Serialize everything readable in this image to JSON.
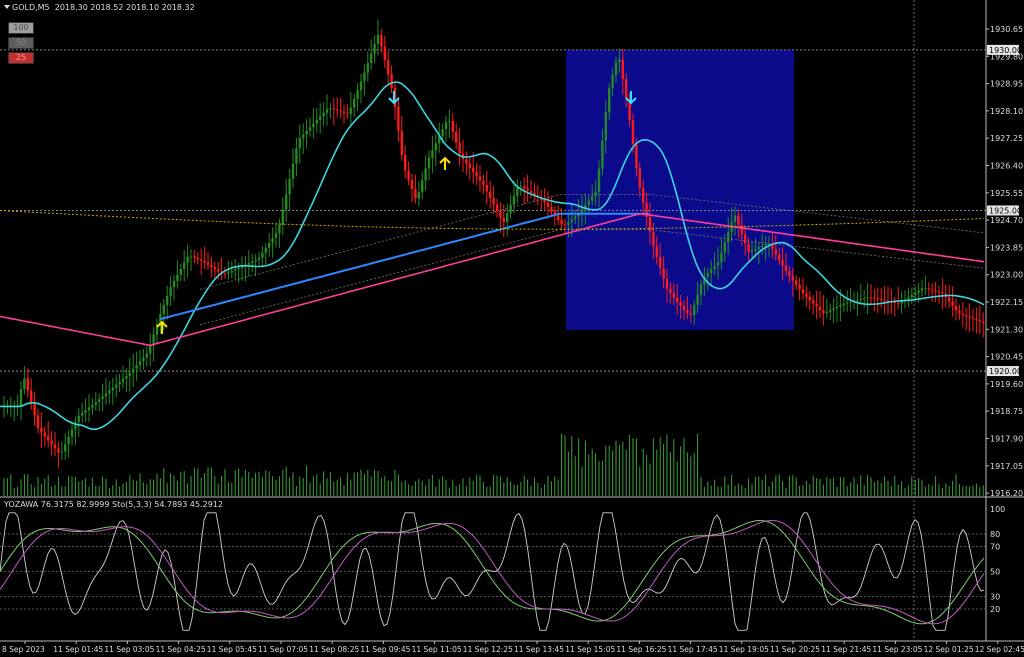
{
  "header": {
    "symbol": "GOLD,M5",
    "ohlc": "2018.30 2018.52 2018.10 2018.32"
  },
  "zoom_buttons": [
    {
      "label": "100",
      "bg": "#9e9e9e",
      "fg": "#4a4a4a"
    },
    {
      "label": "50",
      "bg": "#5e5e5e",
      "fg": "#8a8a8a"
    },
    {
      "label": "25",
      "bg": "#c03030",
      "fg": "#ff9999"
    }
  ],
  "price_axis": {
    "ticks": [
      "1930.65",
      "1929.80",
      "1928.95",
      "1928.10",
      "1927.25",
      "1926.40",
      "1925.55",
      "1924.70",
      "1923.85",
      "1923.00",
      "1922.15",
      "1921.30",
      "1920.45",
      "1919.60",
      "1918.75",
      "1917.90",
      "1917.05",
      "1916.20"
    ],
    "highlight_labels": [
      "1930.00",
      "1925.00",
      "1920.00"
    ]
  },
  "indicator": {
    "label": "YOZAWA 76.3175 82.9999  Sto(5,3,3) 54.7893 45.2912",
    "levels": [
      "100",
      "80",
      "70",
      "50",
      "30",
      "20"
    ]
  },
  "time_axis": [
    "8 Sep 2023",
    "11 Sep 01:45",
    "11 Sep 03:05",
    "11 Sep 04:25",
    "11 Sep 05:45",
    "11 Sep 07:05",
    "11 Sep 08:25",
    "11 Sep 09:45",
    "11 Sep 11:05",
    "11 Sep 12:25",
    "11 Sep 13:45",
    "11 Sep 15:05",
    "11 Sep 16:25",
    "11 Sep 17:45",
    "11 Sep 19:05",
    "11 Sep 20:25",
    "11 Sep 21:45",
    "11 Sep 23:05",
    "12 Sep 01:25",
    "12 Sep 02:45"
  ],
  "colors": {
    "bull": "#228b22",
    "bear": "#ff1a1a",
    "ma_fast": "#3fd3e0",
    "ma_slow": "#2f86ff",
    "ma_long": "#ff3c9a",
    "ma_dotted": "#c8b400",
    "box": "#0a0a8a",
    "volume": "#3aa33a",
    "arrow_up": "#ffe000",
    "arrow_down": "#33e0ff"
  }
}
